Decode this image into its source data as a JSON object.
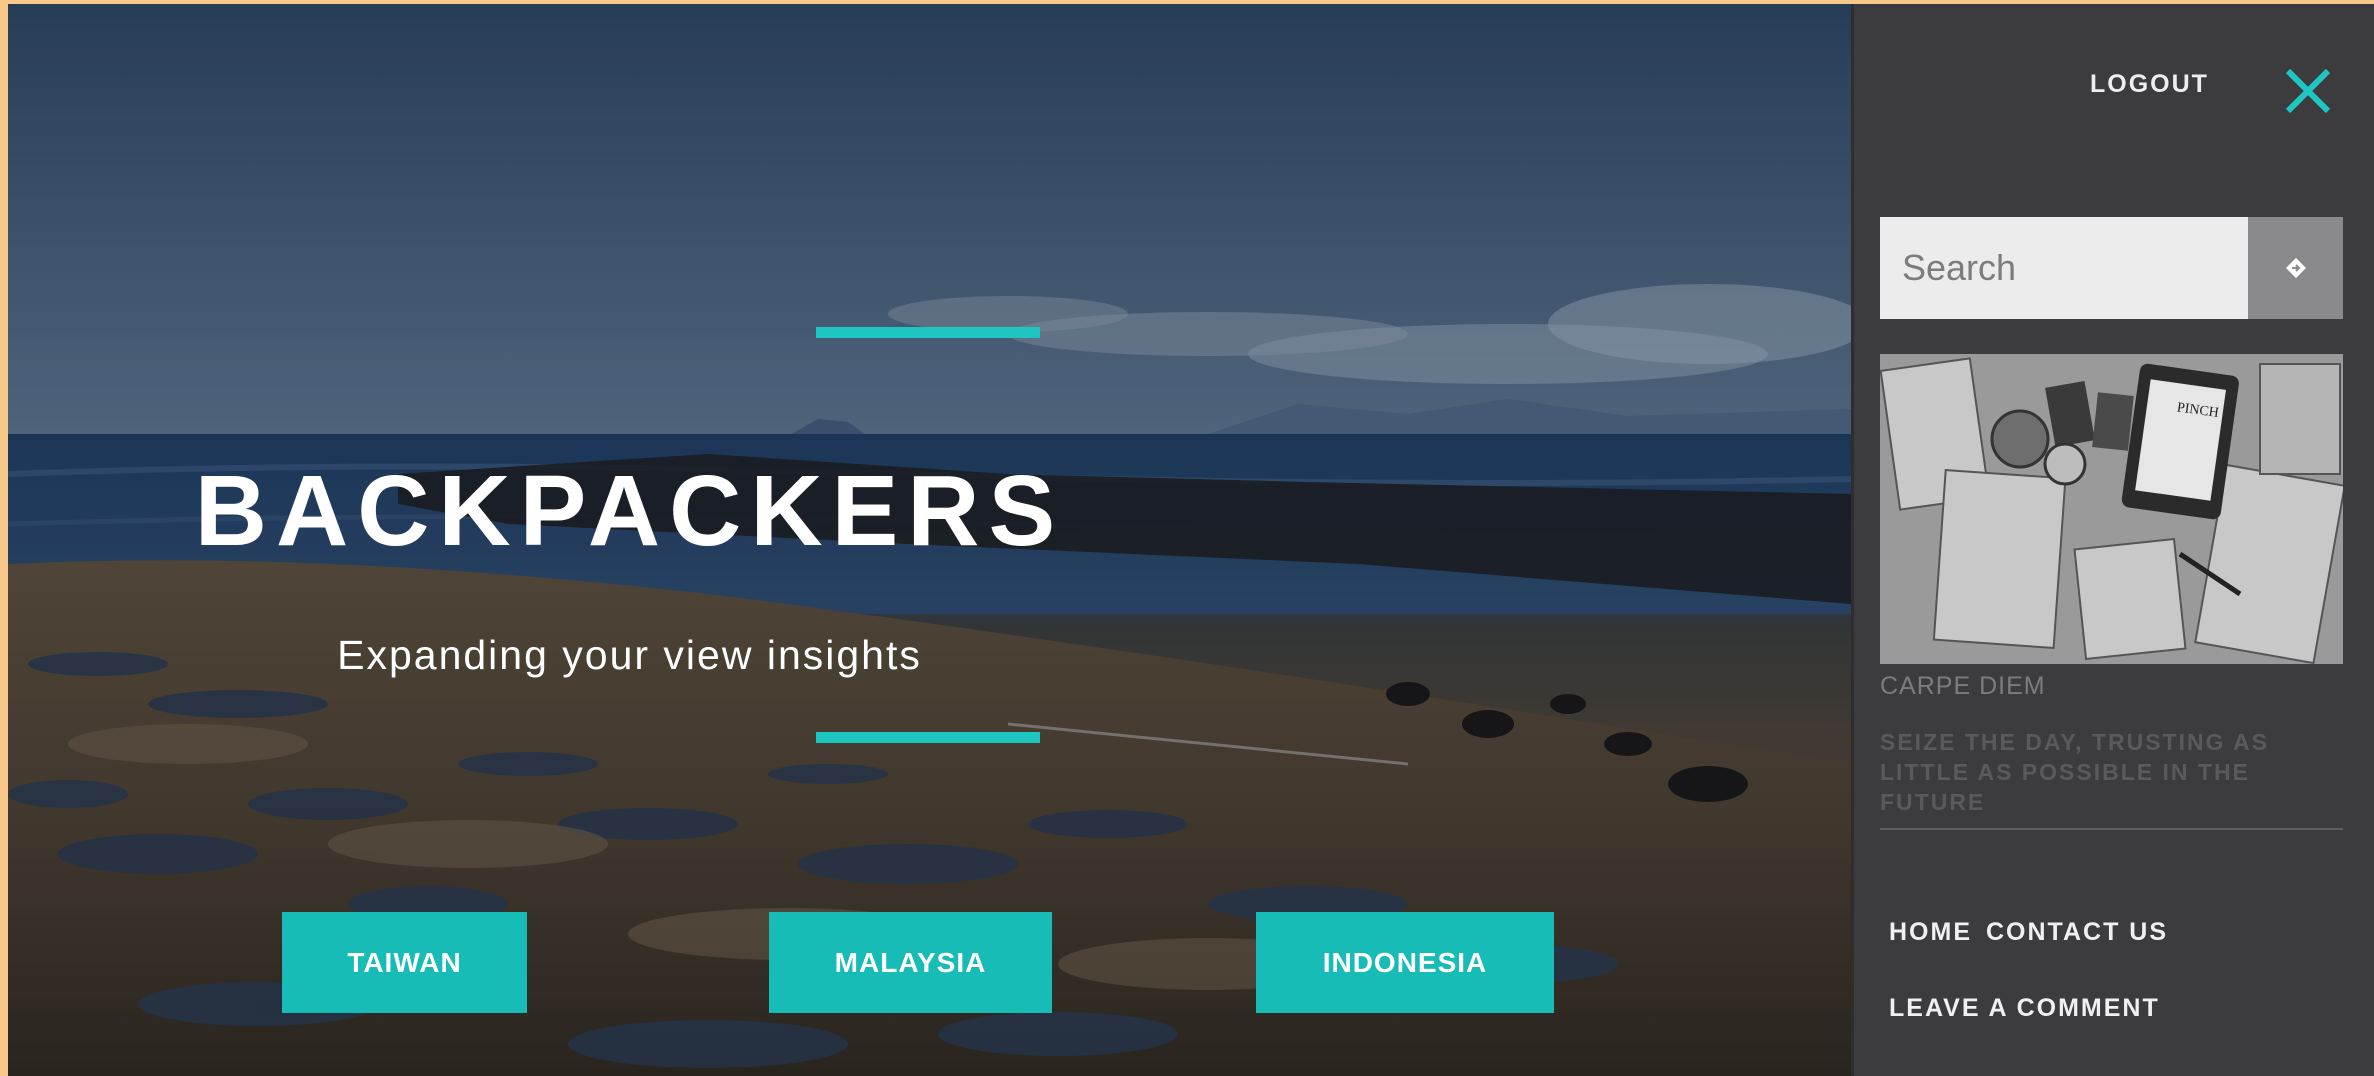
{
  "hero": {
    "title": "BACKPACKERS",
    "subtitle": "Expanding your view insights",
    "accent_color": "#1ec6c2",
    "destinations": [
      {
        "label": "TAIWAN"
      },
      {
        "label": "MALAYSIA"
      },
      {
        "label": "INDONESIA"
      }
    ]
  },
  "panel": {
    "logout_label": "LOGOUT",
    "close_icon": "close-icon",
    "search": {
      "placeholder": "Search",
      "value": "",
      "button_icon": "search-submit-icon"
    },
    "feature": {
      "title": "CARPE DIEM",
      "text": "SEIZE THE DAY, TRUSTING AS LITTLE AS POSSIBLE IN THE FUTURE",
      "image_label": "PINCH"
    },
    "nav": {
      "home": "HOME",
      "contact": "CONTACT US",
      "comment": "LEAVE A COMMENT"
    }
  },
  "colors": {
    "button_bg": "#17bcb7",
    "panel_bg": "#3c3b3d"
  }
}
